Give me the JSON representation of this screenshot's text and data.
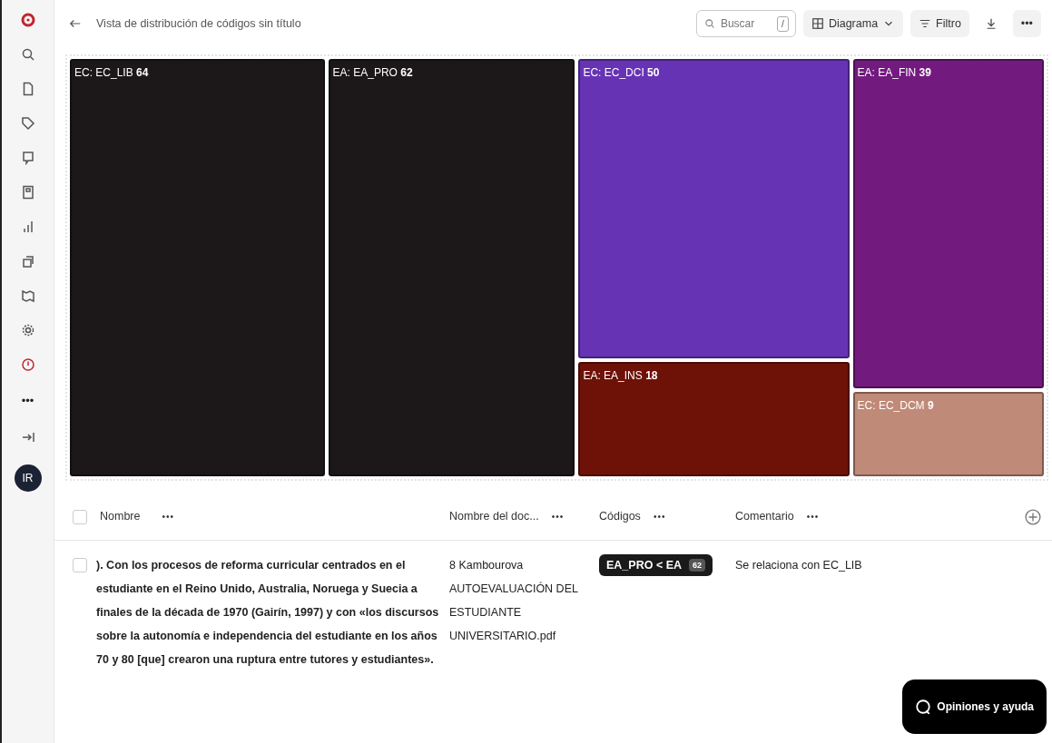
{
  "header": {
    "title": "Vista de distribución de códigos sin título",
    "search": {
      "placeholder": "Buscar",
      "shortcut": "/"
    },
    "view_button": "Diagrama",
    "filter_button": "Filtro",
    "more": "•••"
  },
  "sidebar": {
    "more": "•••",
    "avatar": "IR"
  },
  "treemap": {
    "columns": [
      {
        "tiles": [
          {
            "group": "EC:",
            "code": "EC_LIB",
            "count": "64",
            "color": "#1c1819"
          }
        ]
      },
      {
        "tiles": [
          {
            "group": "EA:",
            "code": "EA_PRO",
            "count": "62",
            "color": "#1c1819"
          }
        ]
      },
      {
        "tiles": [
          {
            "group": "EC:",
            "code": "EC_DCI",
            "count": "50",
            "color": "#6633b5"
          },
          {
            "group": "EA:",
            "code": "EA_INS",
            "count": "18",
            "color": "#6e1208"
          }
        ]
      },
      {
        "tiles": [
          {
            "group": "EA:",
            "code": "EA_FIN",
            "count": "39",
            "color": "#731a7f"
          },
          {
            "group": "EC:",
            "code": "EC_DCM",
            "count": "9",
            "color": "#c08a78"
          }
        ]
      }
    ]
  },
  "table": {
    "all_checked": false,
    "columns": [
      {
        "label": "Nombre",
        "more": "•••"
      },
      {
        "label": "Nombre del doc...",
        "more": "•••"
      },
      {
        "label": "Códigos",
        "more": "•••"
      },
      {
        "label": "Comentario",
        "more": "•••"
      }
    ],
    "rows": [
      {
        "checked": false,
        "name": "). Con los procesos de reforma curricular centrados en el estudiante en el Reino Unido, Australia, Noruega y Suecia a finales de la década de 1970 (Gairín, 1997) y con «los discursos sobre la autonomía e independencia del estudiante en los años 70 y 80 [que] crearon una ruptura entre tutores y estudiantes».",
        "document": [
          "8 Kambourova",
          "AUTOEVALUACIÓN DEL",
          "ESTUDIANTE",
          "UNIVERSITARIO.pdf"
        ],
        "code": {
          "label": "EA_PRO < EA",
          "count": "62"
        },
        "comment": "Se relaciona con EC_LIB"
      }
    ]
  },
  "feedback_button": "Opiniones y ayuda"
}
